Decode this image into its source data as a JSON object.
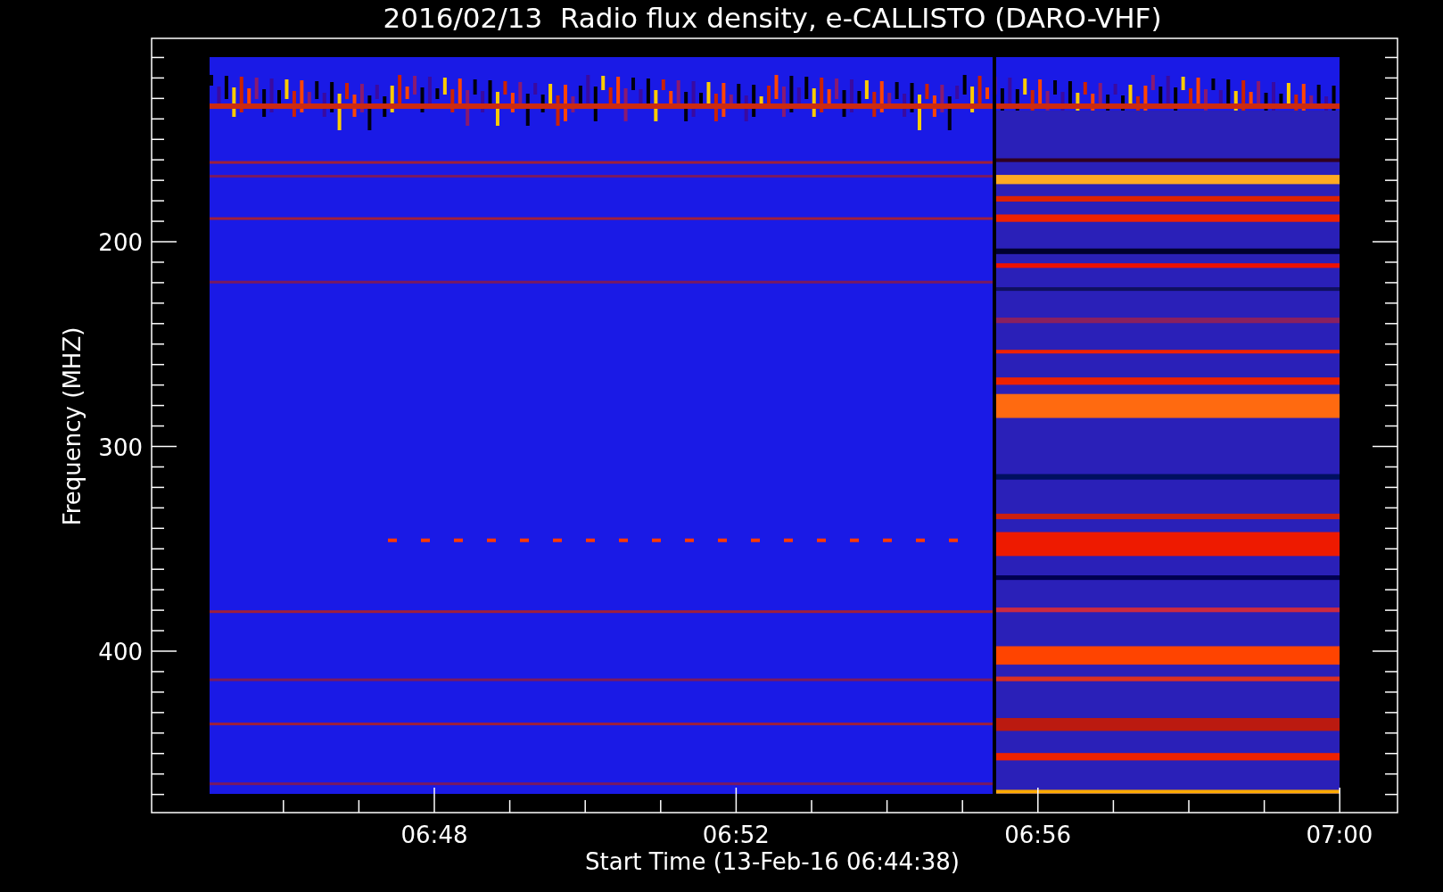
{
  "title": "2016/02/13  Radio flux density, e-CALLISTO (DARO-VHF)",
  "y_axis": {
    "label": "Frequency (MHZ)",
    "ticks": [
      "200",
      "300",
      "400"
    ]
  },
  "x_axis": {
    "label": "Start Time (13-Feb-16 06:44:38)",
    "ticks": [
      "06:48",
      "06:52",
      "06:56",
      "07:00"
    ]
  }
}
